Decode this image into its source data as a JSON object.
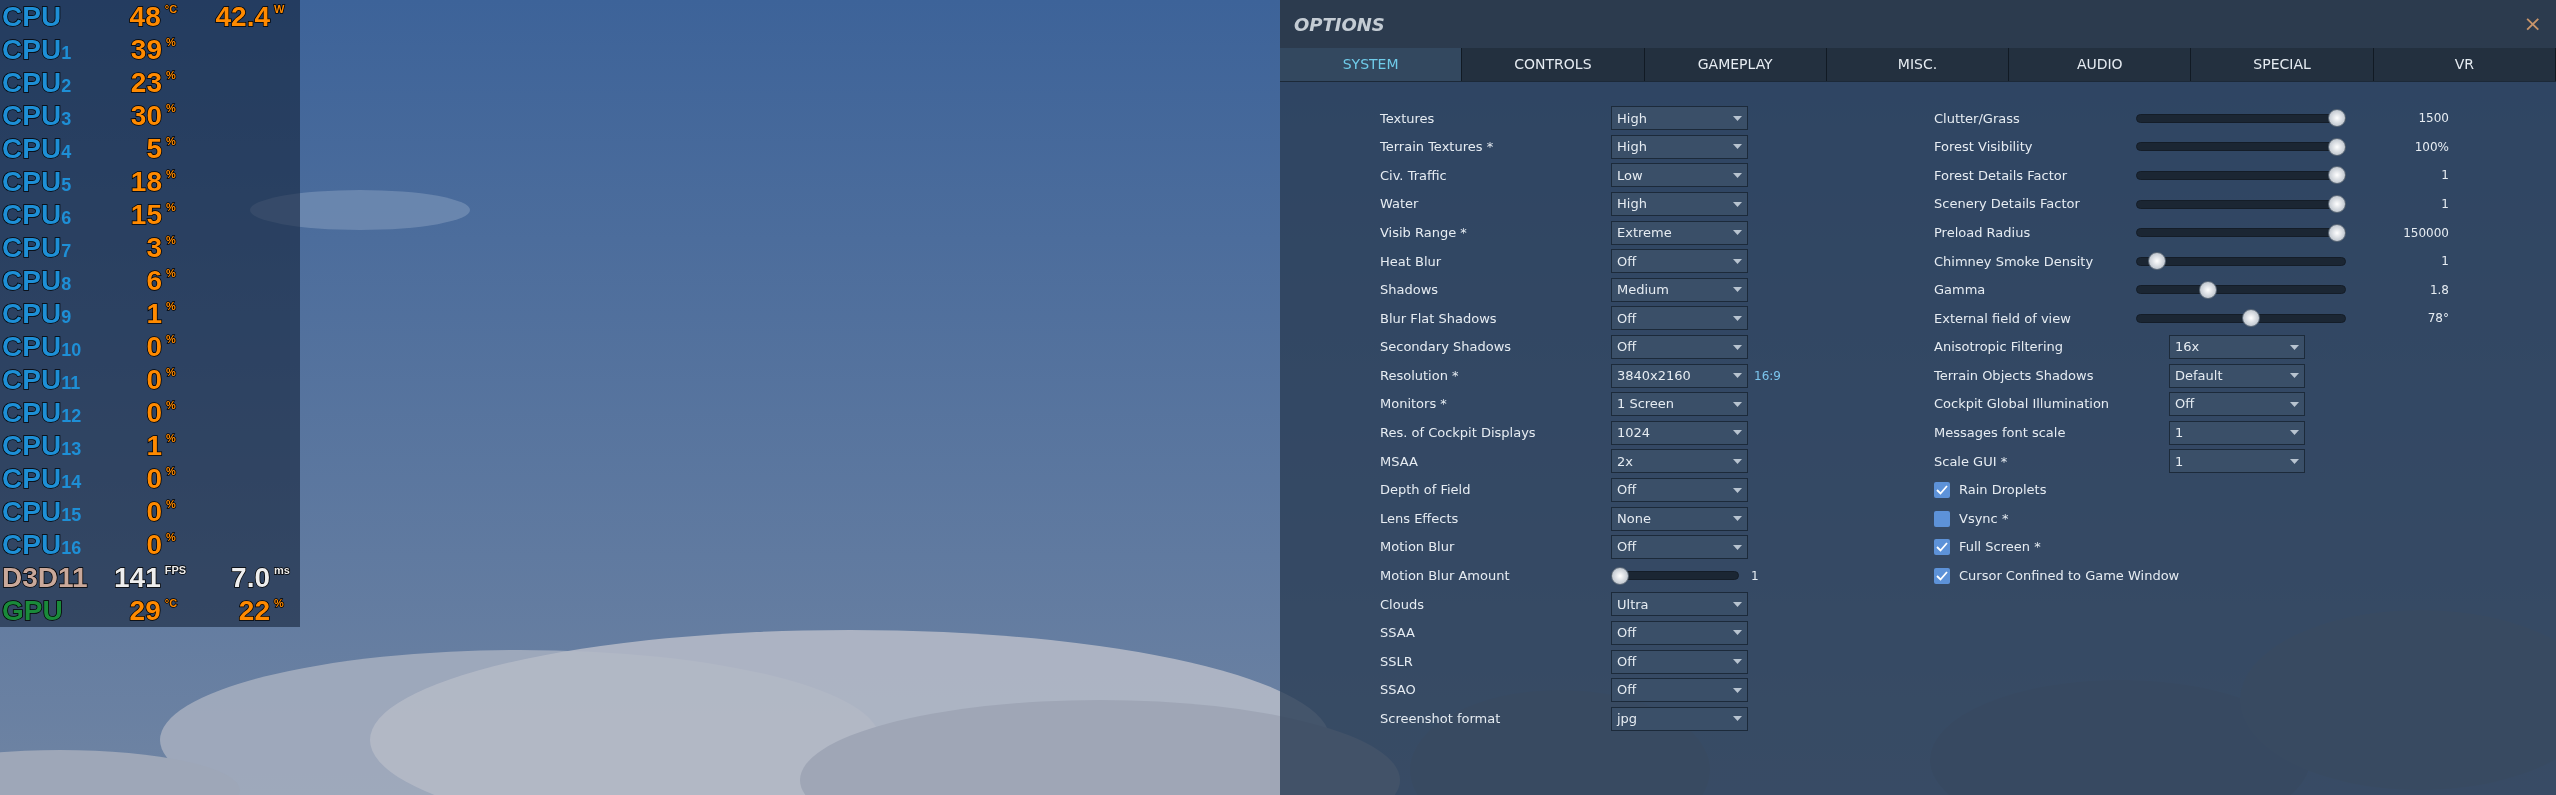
{
  "overlay": [
    {
      "kind": "stat",
      "label": "CPU",
      "color": "#1e8fd6",
      "values": [
        {
          "value": "48",
          "unit": "°C"
        },
        {
          "value": "42.4",
          "unit": "W"
        }
      ]
    },
    {
      "kind": "stat",
      "label": "CPU",
      "sub": "1",
      "color": "#1e8fd6",
      "values": [
        {
          "value": "39",
          "unit": "%"
        }
      ]
    },
    {
      "kind": "stat",
      "label": "CPU",
      "sub": "2",
      "color": "#1e8fd6",
      "values": [
        {
          "value": "23",
          "unit": "%"
        }
      ]
    },
    {
      "kind": "stat",
      "label": "CPU",
      "sub": "3",
      "color": "#1e8fd6",
      "values": [
        {
          "value": "30",
          "unit": "%"
        }
      ]
    },
    {
      "kind": "stat",
      "label": "CPU",
      "sub": "4",
      "color": "#1e8fd6",
      "values": [
        {
          "value": "5",
          "unit": "%"
        }
      ]
    },
    {
      "kind": "stat",
      "label": "CPU",
      "sub": "5",
      "color": "#1e8fd6",
      "values": [
        {
          "value": "18",
          "unit": "%"
        }
      ]
    },
    {
      "kind": "stat",
      "label": "CPU",
      "sub": "6",
      "color": "#1e8fd6",
      "values": [
        {
          "value": "15",
          "unit": "%"
        }
      ]
    },
    {
      "kind": "stat",
      "label": "CPU",
      "sub": "7",
      "color": "#1e8fd6",
      "values": [
        {
          "value": "3",
          "unit": "%"
        }
      ]
    },
    {
      "kind": "stat",
      "label": "CPU",
      "sub": "8",
      "color": "#1e8fd6",
      "values": [
        {
          "value": "6",
          "unit": "%"
        }
      ]
    },
    {
      "kind": "stat",
      "label": "CPU",
      "sub": "9",
      "color": "#1e8fd6",
      "values": [
        {
          "value": "1",
          "unit": "%"
        }
      ]
    },
    {
      "kind": "stat",
      "label": "CPU",
      "sub": "10",
      "color": "#1e8fd6",
      "values": [
        {
          "value": "0",
          "unit": "%"
        }
      ]
    },
    {
      "kind": "stat",
      "label": "CPU",
      "sub": "11",
      "color": "#1e8fd6",
      "values": [
        {
          "value": "0",
          "unit": "%"
        }
      ]
    },
    {
      "kind": "stat",
      "label": "CPU",
      "sub": "12",
      "color": "#1e8fd6",
      "values": [
        {
          "value": "0",
          "unit": "%"
        }
      ]
    },
    {
      "kind": "stat",
      "label": "CPU",
      "sub": "13",
      "color": "#1e8fd6",
      "values": [
        {
          "value": "1",
          "unit": "%"
        }
      ]
    },
    {
      "kind": "stat",
      "label": "CPU",
      "sub": "14",
      "color": "#1e8fd6",
      "values": [
        {
          "value": "0",
          "unit": "%"
        }
      ]
    },
    {
      "kind": "stat",
      "label": "CPU",
      "sub": "15",
      "color": "#1e8fd6",
      "values": [
        {
          "value": "0",
          "unit": "%"
        }
      ]
    },
    {
      "kind": "stat",
      "label": "CPU",
      "sub": "16",
      "color": "#1e8fd6",
      "values": [
        {
          "value": "0",
          "unit": "%"
        }
      ]
    },
    {
      "kind": "fps",
      "label": "D3D11",
      "color": "#c9a89a",
      "values": [
        {
          "value": "141",
          "unit": "FPS"
        },
        {
          "value": "7.0",
          "unit": "ms"
        }
      ]
    },
    {
      "kind": "stat",
      "label": "GPU",
      "color": "#1a8a3a",
      "values": [
        {
          "value": "29",
          "unit": "°C"
        },
        {
          "value": "22",
          "unit": "%"
        }
      ]
    }
  ],
  "window": {
    "title": "OPTIONS",
    "close": "×"
  },
  "tabs": [
    {
      "label": "SYSTEM",
      "selected": true
    },
    {
      "label": "CONTROLS",
      "selected": false
    },
    {
      "label": "GAMEPLAY",
      "selected": false
    },
    {
      "label": "MISC.",
      "selected": false
    },
    {
      "label": "AUDIO",
      "selected": false
    },
    {
      "label": "SPECIAL",
      "selected": false
    },
    {
      "label": "VR",
      "selected": false
    }
  ],
  "left_settings": [
    {
      "kind": "select",
      "label": "Textures",
      "value": "High"
    },
    {
      "kind": "select",
      "label": "Terrain Textures *",
      "value": "High"
    },
    {
      "kind": "select",
      "label": "Civ. Traffic",
      "value": "Low"
    },
    {
      "kind": "select",
      "label": "Water",
      "value": "High"
    },
    {
      "kind": "select",
      "label": "Visib Range *",
      "value": "Extreme"
    },
    {
      "kind": "select",
      "label": "Heat Blur",
      "value": "Off"
    },
    {
      "kind": "select",
      "label": "Shadows",
      "value": "Medium"
    },
    {
      "kind": "select",
      "label": "Blur Flat Shadows",
      "value": "Off"
    },
    {
      "kind": "select",
      "label": "Secondary Shadows",
      "value": "Off"
    },
    {
      "kind": "select",
      "label": "Resolution *",
      "value": "3840x2160",
      "note": "16:9"
    },
    {
      "kind": "select",
      "label": "Monitors *",
      "value": "1 Screen"
    },
    {
      "kind": "select",
      "label": "Res. of Cockpit Displays",
      "value": "1024"
    },
    {
      "kind": "select",
      "label": "MSAA",
      "value": "2x"
    },
    {
      "kind": "select",
      "label": "Depth of Field",
      "value": "Off"
    },
    {
      "kind": "select",
      "label": "Lens Effects",
      "value": "None"
    },
    {
      "kind": "select",
      "label": "Motion Blur",
      "value": "Off"
    },
    {
      "kind": "slider",
      "label": "Motion Blur Amount",
      "level": 0,
      "reading": "1"
    },
    {
      "kind": "select",
      "label": "Clouds",
      "value": "Ultra"
    },
    {
      "kind": "select",
      "label": "SSAA",
      "value": "Off"
    },
    {
      "kind": "select",
      "label": "SSLR",
      "value": "Off"
    },
    {
      "kind": "select",
      "label": "SSAO",
      "value": "Off"
    },
    {
      "kind": "select",
      "label": "Screenshot format",
      "value": "jpg"
    }
  ],
  "right_settings": [
    {
      "kind": "slider",
      "label": "Clutter/Grass",
      "level": 1,
      "reading": "1500"
    },
    {
      "kind": "slider",
      "label": "Forest Visibility",
      "level": 1,
      "reading": "100%"
    },
    {
      "kind": "slider",
      "label": "Forest Details Factor",
      "level": 1,
      "reading": "1"
    },
    {
      "kind": "slider",
      "label": "Scenery Details Factor",
      "level": 1,
      "reading": "1"
    },
    {
      "kind": "slider",
      "label": "Preload Radius",
      "level": 1,
      "reading": "150000"
    },
    {
      "kind": "slider",
      "label": "Chimney Smoke Density",
      "level": 0.06,
      "reading": "1"
    },
    {
      "kind": "slider",
      "label": "Gamma",
      "level": 0.33,
      "reading": "1.8"
    },
    {
      "kind": "slider",
      "label": "External field of view",
      "level": 0.55,
      "reading": "78°"
    },
    {
      "kind": "select",
      "label": "Anisotropic Filtering",
      "value": "16x"
    },
    {
      "kind": "select",
      "label": "Terrain Objects Shadows",
      "value": "Default"
    },
    {
      "kind": "select",
      "label": "Cockpit Global Illumination",
      "value": "Off"
    },
    {
      "kind": "select",
      "label": "Messages font scale",
      "value": "1"
    },
    {
      "kind": "select",
      "label": "Scale GUI *",
      "value": "1"
    },
    {
      "kind": "checkbox",
      "label": "Rain Droplets",
      "checked": true
    },
    {
      "kind": "checkbox",
      "label": "Vsync *",
      "checked": false
    },
    {
      "kind": "checkbox",
      "label": "Full Screen *",
      "checked": true
    },
    {
      "kind": "checkbox",
      "label": "Cursor Confined to Game Window",
      "checked": true
    }
  ]
}
